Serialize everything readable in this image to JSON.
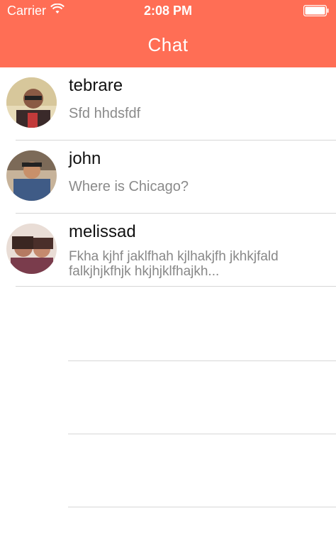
{
  "status_bar": {
    "carrier": "Carrier",
    "time": "2:08 PM",
    "wifi_icon": "wifi-icon",
    "battery_icon": "battery-icon"
  },
  "nav": {
    "title": "Chat",
    "bar_color": "#FF6E55"
  },
  "chats": [
    {
      "name": "tebrare",
      "preview": "Sfd hhdsfdf"
    },
    {
      "name": "john",
      "preview": "Where is Chicago?"
    },
    {
      "name": "melissad",
      "preview": "Fkha kjhf jaklfhah kjlhakjfh jkhkjfald falkjhjkfhjk hkjhjklfhajkh..."
    }
  ]
}
